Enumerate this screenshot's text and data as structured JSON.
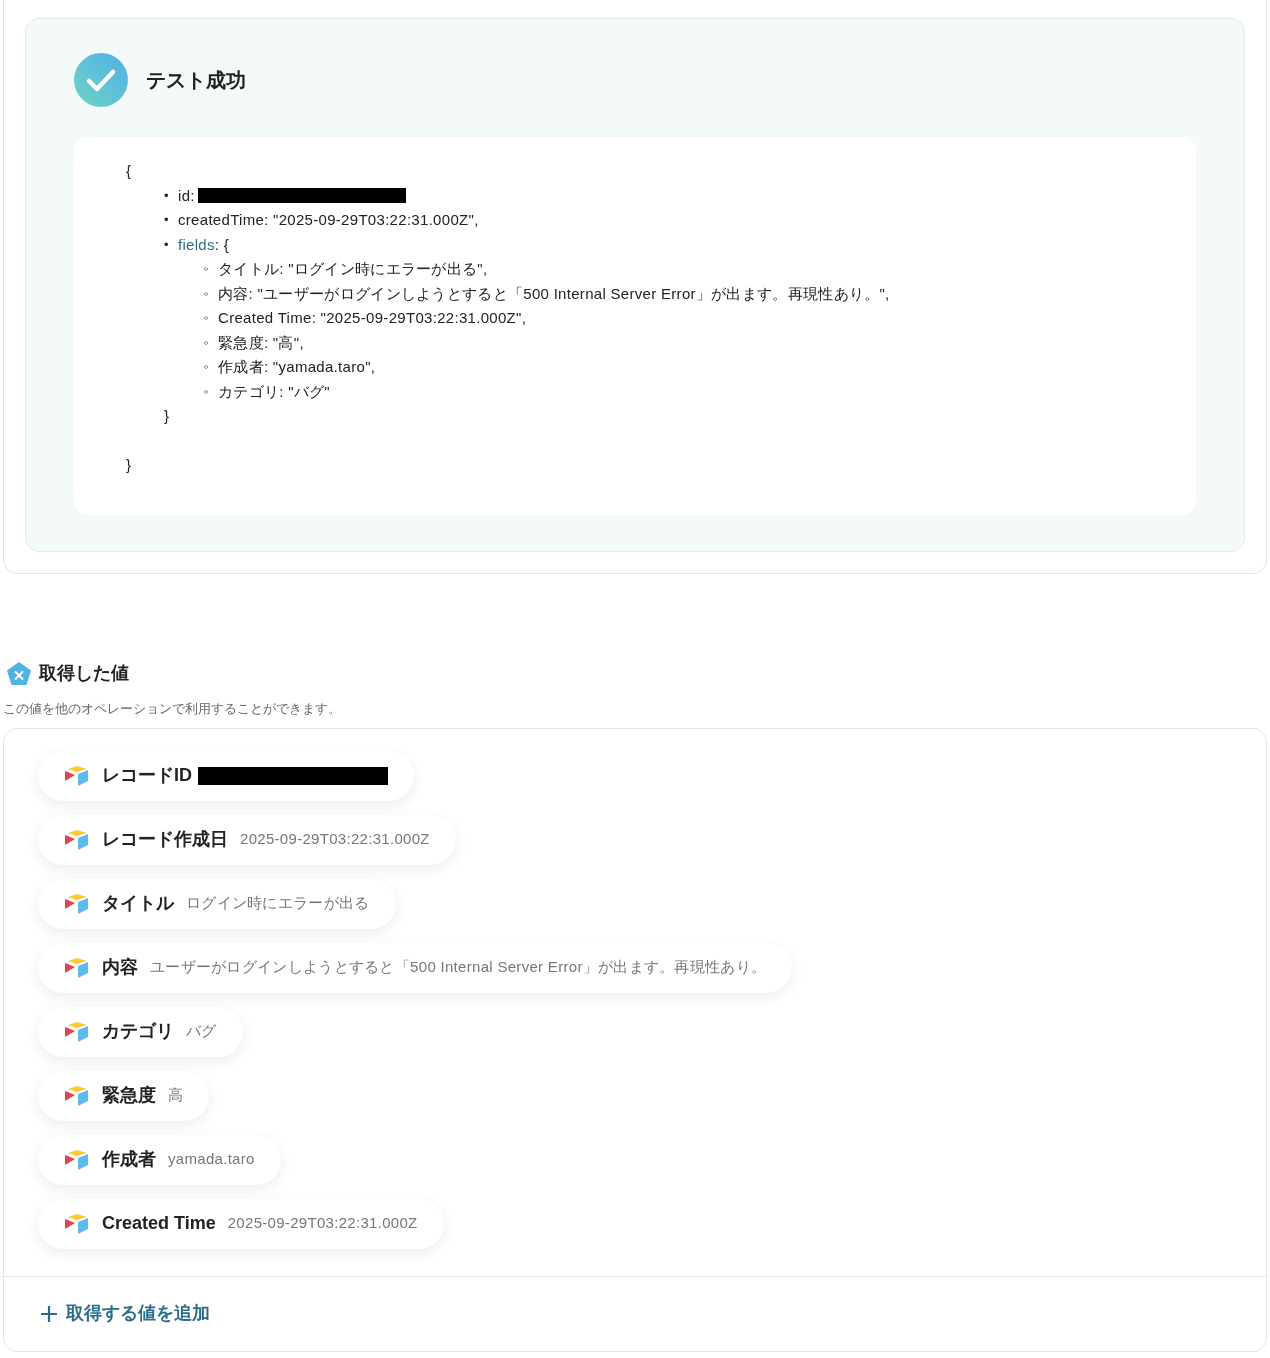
{
  "test_result": {
    "succeeded": true,
    "title": "テスト成功",
    "code": {
      "open": "{",
      "close": "}",
      "items": [
        {
          "kind": "redacted",
          "bullet": "•",
          "text": "id:"
        },
        {
          "kind": "text",
          "bullet": "•",
          "text": "createdTime: \"2025-09-29T03:22:31.000Z\","
        },
        {
          "kind": "object",
          "bullet": "•",
          "key": "fields",
          "text": ": {",
          "close": "}",
          "children": [
            {
              "bullet": "◦",
              "text": "タイトル: \"ログイン時にエラーが出る\","
            },
            {
              "bullet": "◦",
              "text": "内容: \"ユーザーがログインしようとすると「500 Internal Server Error」が出ます。再現性あり。\","
            },
            {
              "bullet": "◦",
              "text": "Created Time: \"2025-09-29T03:22:31.000Z\","
            },
            {
              "bullet": "◦",
              "text": "緊急度: \"高\","
            },
            {
              "bullet": "◦",
              "text": "作成者: \"yamada.taro\","
            },
            {
              "bullet": "◦",
              "text": "カテゴリ: \"バグ\""
            }
          ]
        }
      ]
    }
  },
  "acquired": {
    "title": "取得した値",
    "description": "この値を他のオペレーションで利用することができます。",
    "chips": [
      {
        "kind": "redacted",
        "label": "レコードID"
      },
      {
        "kind": "value",
        "label": "レコード作成日",
        "value": "2025-09-29T03:22:31.000Z"
      },
      {
        "kind": "value",
        "label": "タイトル",
        "value": "ログイン時にエラーが出る"
      },
      {
        "kind": "value",
        "label": "内容",
        "value": "ユーザーがログインしようとすると「500 Internal Server Error」が出ます。再現性あり。"
      },
      {
        "kind": "value",
        "label": "カテゴリ",
        "value": "バグ"
      },
      {
        "kind": "value",
        "label": "緊急度",
        "value": "高"
      },
      {
        "kind": "value",
        "label": "作成者",
        "value": "yamada.taro"
      },
      {
        "kind": "value",
        "label": "Created Time",
        "value": "2025-09-29T03:22:31.000Z"
      }
    ],
    "add_button": "取得する値を追加"
  }
}
